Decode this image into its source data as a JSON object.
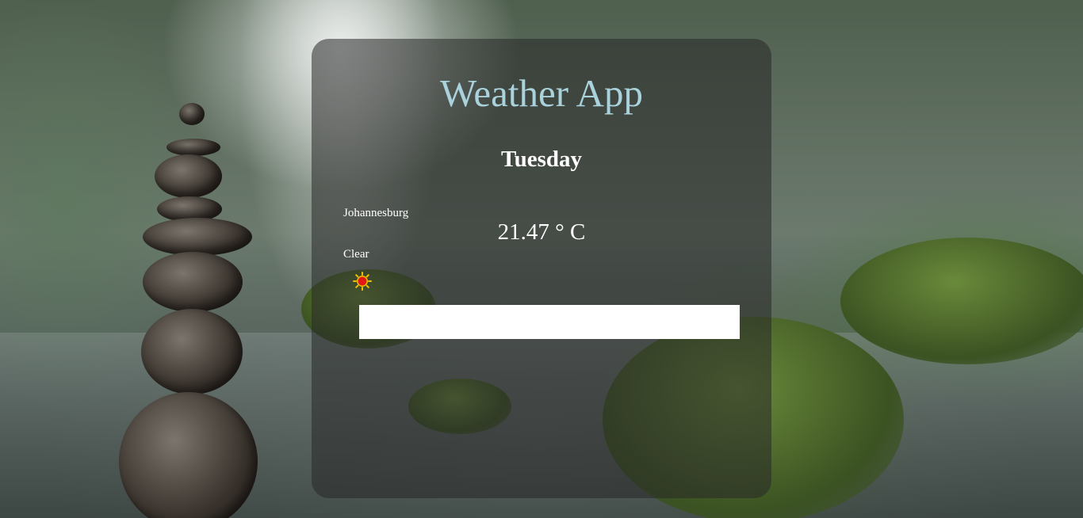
{
  "app": {
    "title": "Weather App"
  },
  "weather": {
    "day": "Tuesday",
    "city": "Johannesburg",
    "temperature": "21.47 ° C",
    "condition": "Clear",
    "condition_icon": "sun-icon"
  },
  "search": {
    "value": "",
    "placeholder": ""
  },
  "colors": {
    "title": "#a9d2dc",
    "card_background": "rgba(40,40,40,0.55)",
    "text": "#ffffff",
    "sun_core": "#e01818",
    "sun_rays": "#f2c200"
  }
}
